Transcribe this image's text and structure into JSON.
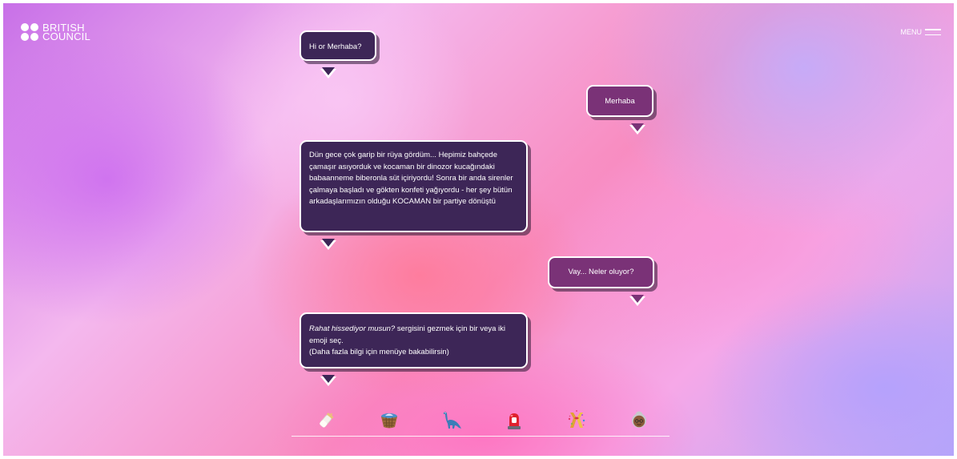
{
  "brand": {
    "line1": "BRITISH",
    "line2": "COUNCIL"
  },
  "menu": {
    "label": "MENU"
  },
  "chat": {
    "messages": [
      {
        "text": "Hi or Merhaba?"
      },
      {
        "text": "Merhaba"
      },
      {
        "text": "Dün gece çok garip bir rüya gördüm... Hepimiz bahçede çamaşır asıyorduk ve kocaman bir dinozor kucağındaki babaanneme biberonla süt içiriyordu! Sonra bir anda sirenler çalmaya başladı ve gökten konfeti yağıyordu - her şey bütün arkadaşlarımızın olduğu KOCAMAN bir partiye dönüştü"
      },
      {
        "text": "Vay... Neler oluyor?"
      },
      {
        "text_italic": "Rahat hissediyor musun?",
        "text_rest": " sergisini gezmek için bir veya iki emoji seç.",
        "text_note": "(Daha fazla bilgi için menüye bakabilirsin)"
      }
    ]
  },
  "emoji_choices": [
    {
      "icon": "baby-bottle-icon"
    },
    {
      "icon": "laundry-basket-icon"
    },
    {
      "icon": "dinosaur-icon"
    },
    {
      "icon": "siren-icon"
    },
    {
      "icon": "confetti-icon"
    },
    {
      "icon": "grandmother-icon"
    }
  ],
  "colors": {
    "bubble_dark": "#3d2657",
    "bubble_reply": "#7a3277",
    "bubble_border": "#ffffff"
  }
}
